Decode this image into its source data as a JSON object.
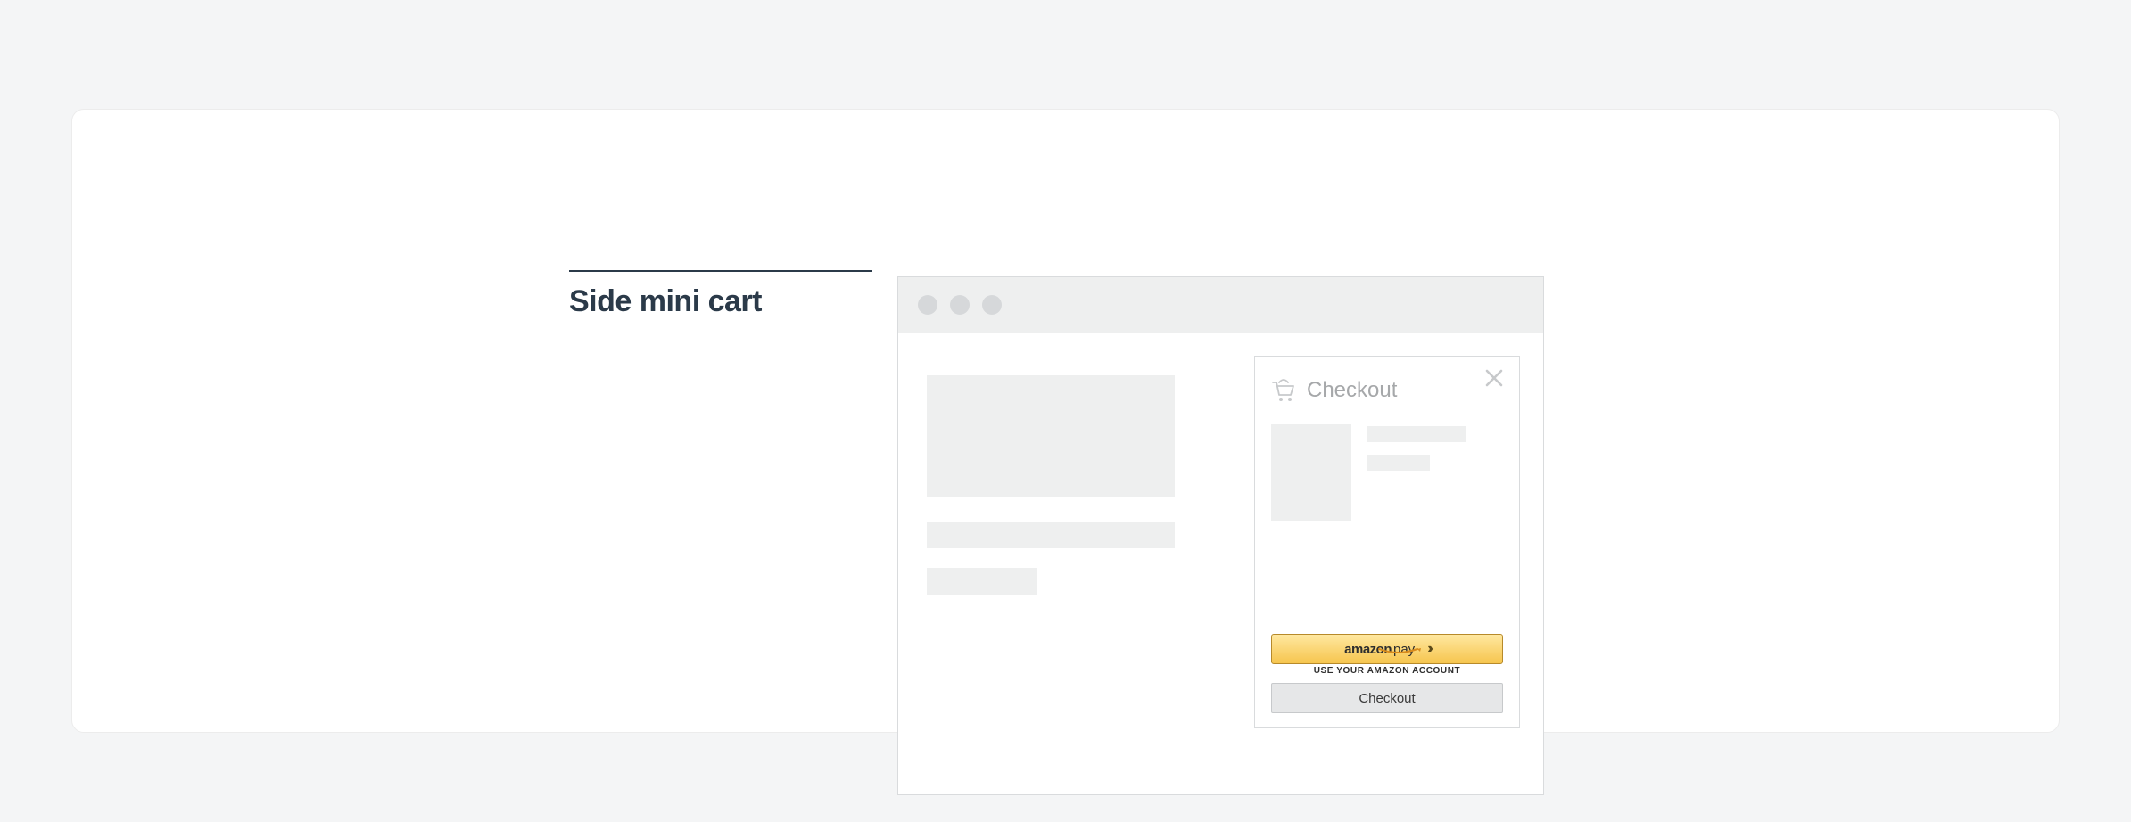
{
  "label": "Side mini cart",
  "mini_cart": {
    "title": "Checkout",
    "amazon_pay": {
      "brand_bold": "amazon",
      "brand_light": "pay",
      "subtext": "USE YOUR AMAZON ACCOUNT"
    },
    "checkout_button": "Checkout"
  }
}
